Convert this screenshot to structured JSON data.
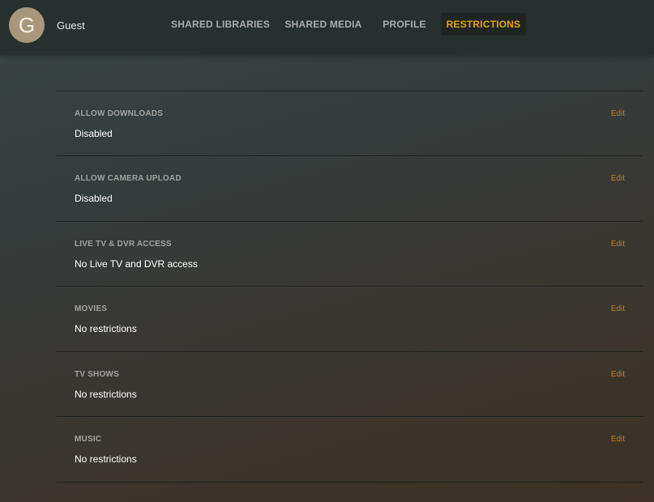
{
  "header": {
    "avatar_letter": "G",
    "username": "Guest",
    "tabs": [
      {
        "label": "SHARED LIBRARIES",
        "active": false
      },
      {
        "label": "SHARED MEDIA",
        "active": false
      },
      {
        "label": "PROFILE",
        "active": false
      },
      {
        "label": "RESTRICTIONS",
        "active": true
      }
    ]
  },
  "restrictions": [
    {
      "label": "ALLOW DOWNLOADS",
      "value": "Disabled",
      "edit": "Edit"
    },
    {
      "label": "ALLOW CAMERA UPLOAD",
      "value": "Disabled",
      "edit": "Edit"
    },
    {
      "label": "LIVE TV & DVR ACCESS",
      "value": "No Live TV and DVR access",
      "edit": "Edit"
    },
    {
      "label": "MOVIES",
      "value": "No restrictions",
      "edit": "Edit"
    },
    {
      "label": "TV SHOWS",
      "value": "No restrictions",
      "edit": "Edit"
    },
    {
      "label": "MUSIC",
      "value": "No restrictions",
      "edit": "Edit"
    }
  ],
  "colors": {
    "accent": "#e5a00d",
    "edit": "#cc7b19",
    "header_bg": "#27302f"
  }
}
